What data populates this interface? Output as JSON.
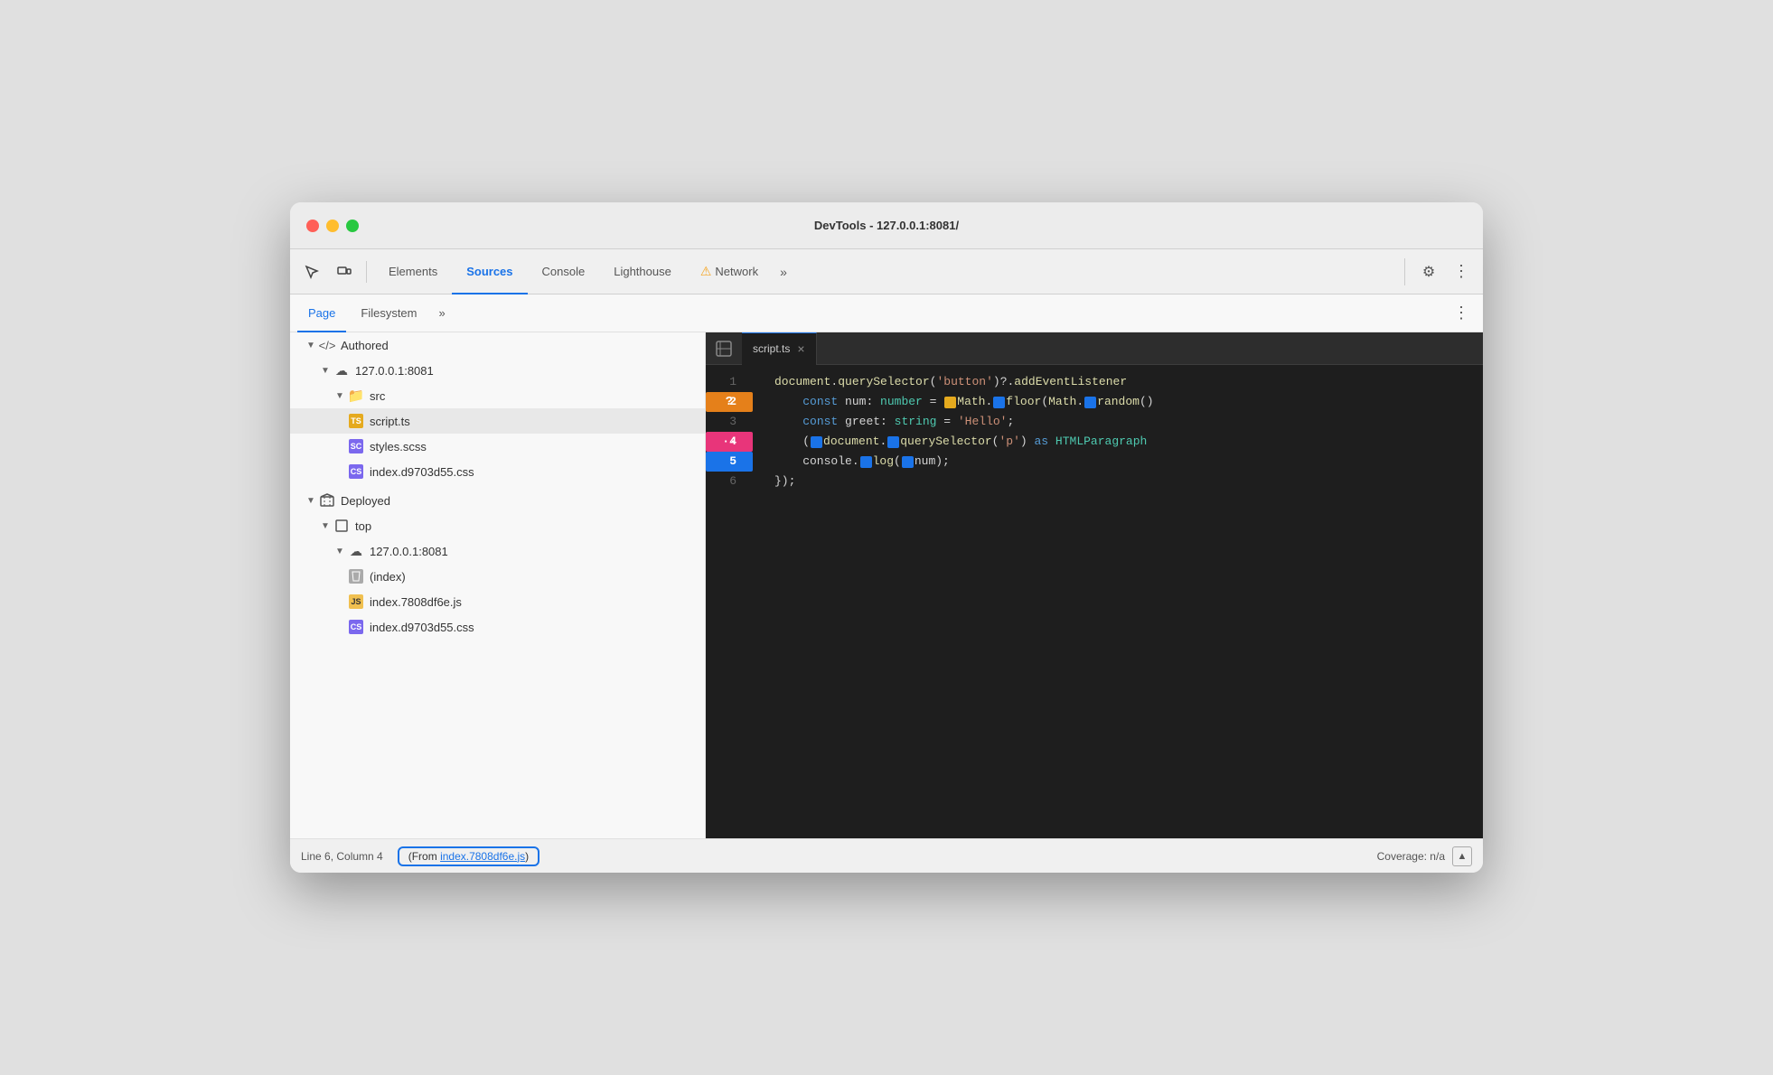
{
  "window": {
    "title": "DevTools - 127.0.0.1:8081/"
  },
  "toolbar": {
    "tabs": [
      {
        "id": "elements",
        "label": "Elements",
        "active": false
      },
      {
        "id": "sources",
        "label": "Sources",
        "active": true
      },
      {
        "id": "console",
        "label": "Console",
        "active": false
      },
      {
        "id": "lighthouse",
        "label": "Lighthouse",
        "active": false
      },
      {
        "id": "network",
        "label": "Network",
        "active": false
      }
    ],
    "more_label": "»",
    "settings_icon": "⚙",
    "menu_icon": "⋮",
    "warning_icon": "⚠"
  },
  "sub_toolbar": {
    "tabs": [
      {
        "id": "page",
        "label": "Page",
        "active": true
      },
      {
        "id": "filesystem",
        "label": "Filesystem",
        "active": false
      }
    ],
    "more_label": "»",
    "menu_icon": "⋮"
  },
  "file_tree": {
    "sections": [
      {
        "label": "Authored",
        "icon": "tag",
        "expanded": true,
        "children": [
          {
            "label": "127.0.0.1:8081",
            "icon": "cloud",
            "expanded": true,
            "children": [
              {
                "label": "src",
                "icon": "folder",
                "expanded": true,
                "children": [
                  {
                    "label": "script.ts",
                    "icon": "ts",
                    "selected": true
                  },
                  {
                    "label": "styles.scss",
                    "icon": "scss"
                  },
                  {
                    "label": "index.d9703d55.css",
                    "icon": "css"
                  }
                ]
              }
            ]
          }
        ]
      },
      {
        "label": "Deployed",
        "icon": "box",
        "expanded": true,
        "children": [
          {
            "label": "top",
            "icon": "rect",
            "expanded": true,
            "children": [
              {
                "label": "127.0.0.1:8081",
                "icon": "cloud",
                "expanded": true,
                "children": [
                  {
                    "label": "(index)",
                    "icon": "html"
                  },
                  {
                    "label": "index.7808df6e.js",
                    "icon": "js"
                  },
                  {
                    "label": "index.d9703d55.css",
                    "icon": "css"
                  }
                ]
              }
            ]
          }
        ]
      }
    ]
  },
  "code_editor": {
    "tab_label": "script.ts",
    "close_icon": "×",
    "lines": [
      {
        "num": 1,
        "gutter": null,
        "code": "document.querySelector('button')?.addEventListener"
      },
      {
        "num": 2,
        "gutter": "question",
        "gutter_color": "orange",
        "code": "    const num: number = Math.floor(Math.random()"
      },
      {
        "num": 3,
        "gutter": null,
        "code": "    const greet: string = 'Hello';"
      },
      {
        "num": 4,
        "gutter": "dots",
        "gutter_color": "pink",
        "code": "    (document.querySelector('p') as HTMLParagraph"
      },
      {
        "num": 5,
        "gutter": "5",
        "gutter_color": "blue",
        "code": "    console.log(num);"
      },
      {
        "num": 6,
        "gutter": null,
        "code": "});"
      }
    ]
  },
  "status_bar": {
    "position": "Line 6, Column 4",
    "source_label": "From index.7808df6e.js",
    "source_link": "index.7808df6e.js",
    "coverage_label": "Coverage: n/a",
    "coverage_icon": "▲"
  }
}
